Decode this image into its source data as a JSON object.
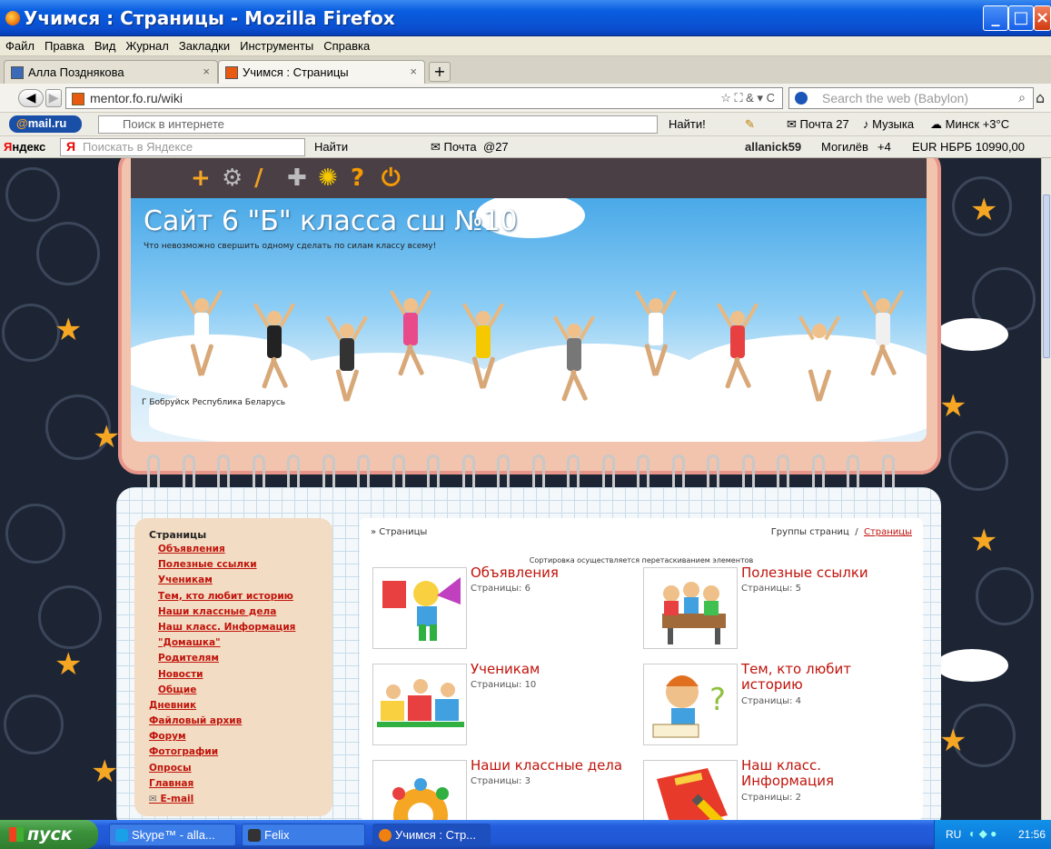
{
  "window": {
    "title": "Учимся : Страницы - Mozilla Firefox"
  },
  "menu": [
    "Файл",
    "Правка",
    "Вид",
    "Журнал",
    "Закладки",
    "Инструменты",
    "Справка"
  ],
  "tabs": [
    {
      "label": "Алла Позднякова",
      "close": "×"
    },
    {
      "label": "Учимся : Страницы",
      "close": "×"
    }
  ],
  "newtab": "+",
  "nav": {
    "url": "mentor.fo.ru/wiki",
    "url_right": "☆  ⛶ & ▾ C",
    "search_placeholder": "Search the web (Babylon)"
  },
  "mailru": {
    "logo_a": "@",
    "logo_b": "mail.ru",
    "search_placeholder": "Поиск в интернете",
    "find": "Найти!",
    "mail": "Почта 27",
    "music": "Музыка",
    "weather": "Минск +3°C"
  },
  "yandex": {
    "logo_a": "Я",
    "logo_b": "ндекс",
    "search_placeholder": "Поискать в Яндексе",
    "find": "Найти",
    "mail": "Почта",
    "count": "@27",
    "user": "allanick59",
    "city": "Могилёв",
    "temp": "+4",
    "rate": "EUR НБРБ 10990,00"
  },
  "site": {
    "title": "Сайт 6 \"Б\" класса сш №10",
    "subtitle": "Что невозможно свершить одному сделать по силам классу всему!",
    "location": "Г Бобруйск Республика Беларусь",
    "toolbar_icons": [
      "plus-icon",
      "gear-icon",
      "brush-icon",
      "puzzle-icon",
      "bulb-icon",
      "help-icon",
      "power-icon"
    ],
    "toolbar_colors": [
      "#f5a623",
      "#bbbbbb",
      "#f0a020",
      "#bbbbbb",
      "#f5c800",
      "#f59b00",
      "#f59b00"
    ]
  },
  "sidebar": {
    "heading": "Страницы",
    "subitems": [
      "Объявления",
      "Полезные ссылки",
      "Ученикам",
      "Тем, кто любит историю",
      "Наши классные дела",
      "Наш класс. Информация",
      "\"Домашка\"",
      "Родителям",
      "Новости",
      "Общие"
    ],
    "items": [
      "Дневник",
      "Файловый архив",
      "Форум",
      "Фотографии",
      "Опросы",
      "Главная",
      "E-mail"
    ]
  },
  "main": {
    "breadcrumb": "»  Страницы",
    "groups": "Группы страниц",
    "sep": "/",
    "groups_link": "Страницы",
    "sort_note": "Сортировка осуществляется перетаскиванием элементов",
    "cards": [
      {
        "title": "Объявления",
        "count": "Страницы: 6"
      },
      {
        "title": "Полезные ссылки",
        "count": "Страницы: 5"
      },
      {
        "title": "Ученикам",
        "count": "Страницы: 10"
      },
      {
        "title": "Тем, кто любит историю",
        "count": "Страницы: 4"
      },
      {
        "title": "Наши классные дела",
        "count": "Страницы: 3"
      },
      {
        "title": "Наш класс. Информация",
        "count": "Страницы: 2"
      }
    ]
  },
  "taskbar": {
    "start": "пуск",
    "tasks": [
      "Skype™ - alla...",
      "Felix",
      "Учимся : Стр..."
    ],
    "lang": "RU",
    "clock": "21:56"
  }
}
